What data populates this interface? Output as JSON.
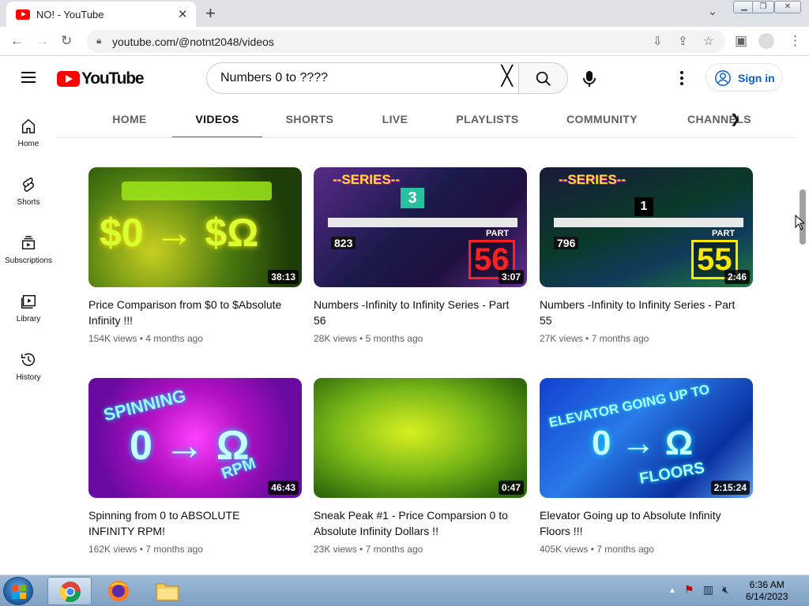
{
  "browser": {
    "tab_title": "NO! - YouTube",
    "url": "youtube.com/@notnt2048/videos"
  },
  "masthead": {
    "logo_text": "YouTube",
    "search_value": "Numbers 0 to ????",
    "signin_label": "Sign in"
  },
  "guide": [
    {
      "label": "Home",
      "icon": "home-icon"
    },
    {
      "label": "Shorts",
      "icon": "shorts-icon"
    },
    {
      "label": "Subscriptions",
      "icon": "subscriptions-icon"
    },
    {
      "label": "Library",
      "icon": "library-icon"
    },
    {
      "label": "History",
      "icon": "history-icon"
    }
  ],
  "channel_tabs": [
    "HOME",
    "VIDEOS",
    "SHORTS",
    "LIVE",
    "PLAYLISTS",
    "COMMUNITY",
    "CHANNELS"
  ],
  "active_tab": "VIDEOS",
  "videos": [
    {
      "title": "Price Comparison from $0 to $Absolute Infinity !!!",
      "views": "154K views",
      "age": "4 months ago",
      "duration": "38:13",
      "thumb_text": "$0  →  $Ω"
    },
    {
      "title": "Numbers -Infinity to Infinity Series - Part 56",
      "views": "28K views",
      "age": "5 months ago",
      "duration": "3:07",
      "thumb_text": "56"
    },
    {
      "title": "Numbers -Infinity to Infinity Series - Part 55",
      "views": "27K views",
      "age": "7 months ago",
      "duration": "2:46",
      "thumb_text": "55"
    },
    {
      "title": "Spinning from 0 to ABSOLUTE INFINITY RPM!",
      "views": "162K views",
      "age": "7 months ago",
      "duration": "46:43",
      "thumb_text": "SPINNING"
    },
    {
      "title": "Sneak Peak #1 - Price Comparsion 0 to Absolute Infinity Dollars !!",
      "views": "23K views",
      "age": "7 months ago",
      "duration": "0:47",
      "thumb_text": ""
    },
    {
      "title": "Elevator Going up to Absolute Infinity Floors !!!",
      "views": "405K views",
      "age": "7 months ago",
      "duration": "2:15:24",
      "thumb_text": "ELEVATOR GOING UP TO"
    }
  ],
  "thumb_extras": {
    "series_label": "--SERIES--",
    "part_label": "PART",
    "part56_num": "823",
    "part55_num": "796",
    "part56_badge": "3",
    "part55_badge": "1",
    "rpm_label": "RPM",
    "floors_label": "FLOORS",
    "zero_omega": "0 → Ω"
  },
  "taskbar": {
    "time": "6:36 AM",
    "date": "6/14/2023"
  },
  "colors": {
    "youtube_red": "#ff0000",
    "link_blue": "#065fd4",
    "taskbar": "#8eaccc"
  }
}
